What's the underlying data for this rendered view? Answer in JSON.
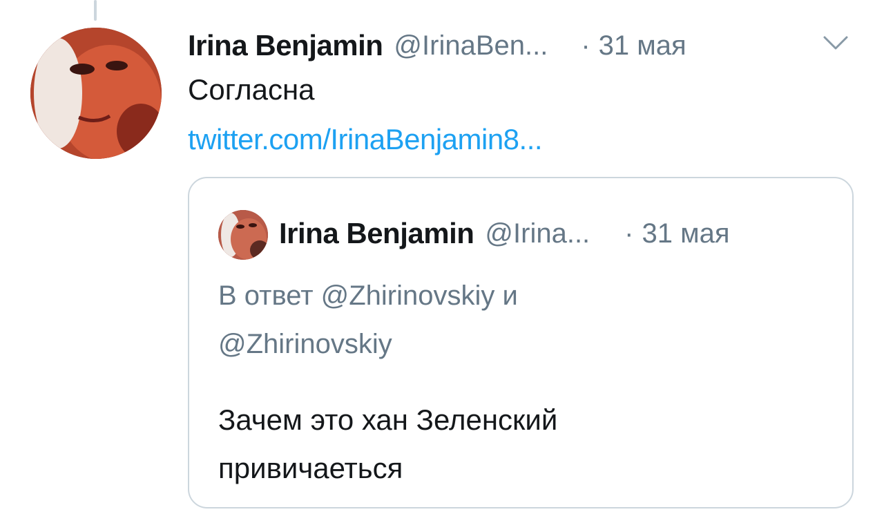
{
  "tweet": {
    "author_name": "Irina Benjamin",
    "author_handle": "@IrinaBen...",
    "separator": "·",
    "date": "31 мая",
    "text": "Согласна",
    "link_text": "twitter.com/IrinaBenjamin8..."
  },
  "quoted_tweet": {
    "author_name": "Irina Benjamin",
    "author_handle": "@Irina...",
    "separator": "·",
    "date": "31 мая",
    "reply_line_1": "В ответ @Zhirinovskiy и",
    "reply_line_2": "@Zhirinovskiy",
    "text_line_1": "Зачем это хан Зеленский",
    "text_line_2": "привичаеться"
  },
  "icons": {
    "menu": "chevron-down-icon"
  },
  "colors": {
    "link": "#1da1f2",
    "secondary_text": "#657786",
    "border": "#ccd6dd"
  }
}
